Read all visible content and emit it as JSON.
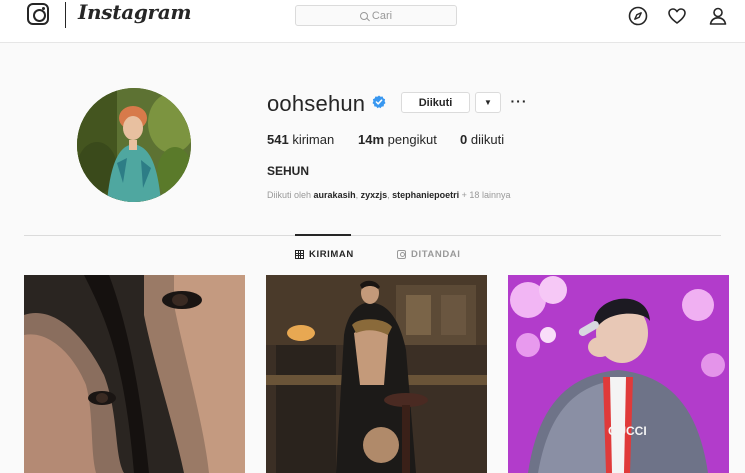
{
  "header": {
    "brand": "Instagram",
    "search": {
      "placeholder": "Cari"
    },
    "nav_icons": [
      "compass-icon",
      "heart-icon",
      "user-icon"
    ]
  },
  "profile": {
    "username": "oohsehun",
    "verified": true,
    "follow_label": "Diikuti",
    "dropdown_icon": "chevron-down-icon",
    "more_icon": "ellipsis-icon",
    "stats": [
      {
        "count": "541",
        "label": "kiriman"
      },
      {
        "count": "14m",
        "label": "pengikut"
      },
      {
        "count": "0",
        "label": "diikuti"
      }
    ],
    "full_name": "SEHUN",
    "followed_by": {
      "prefix": "Diikuti oleh",
      "users": [
        "aurakasih",
        "zyxzjs",
        "stephaniepoetri"
      ],
      "suffix": "+ 18 lainnya"
    }
  },
  "tabs": [
    {
      "label": "KIRIMAN",
      "icon": "grid-icon",
      "active": true
    },
    {
      "label": "DITANDAI",
      "icon": "tag-icon",
      "active": false
    }
  ],
  "colors": {
    "background": "#fafafa",
    "text": "#262626",
    "muted": "#999999",
    "border": "#dbdbdb",
    "verified_blue": "#3897f0"
  }
}
